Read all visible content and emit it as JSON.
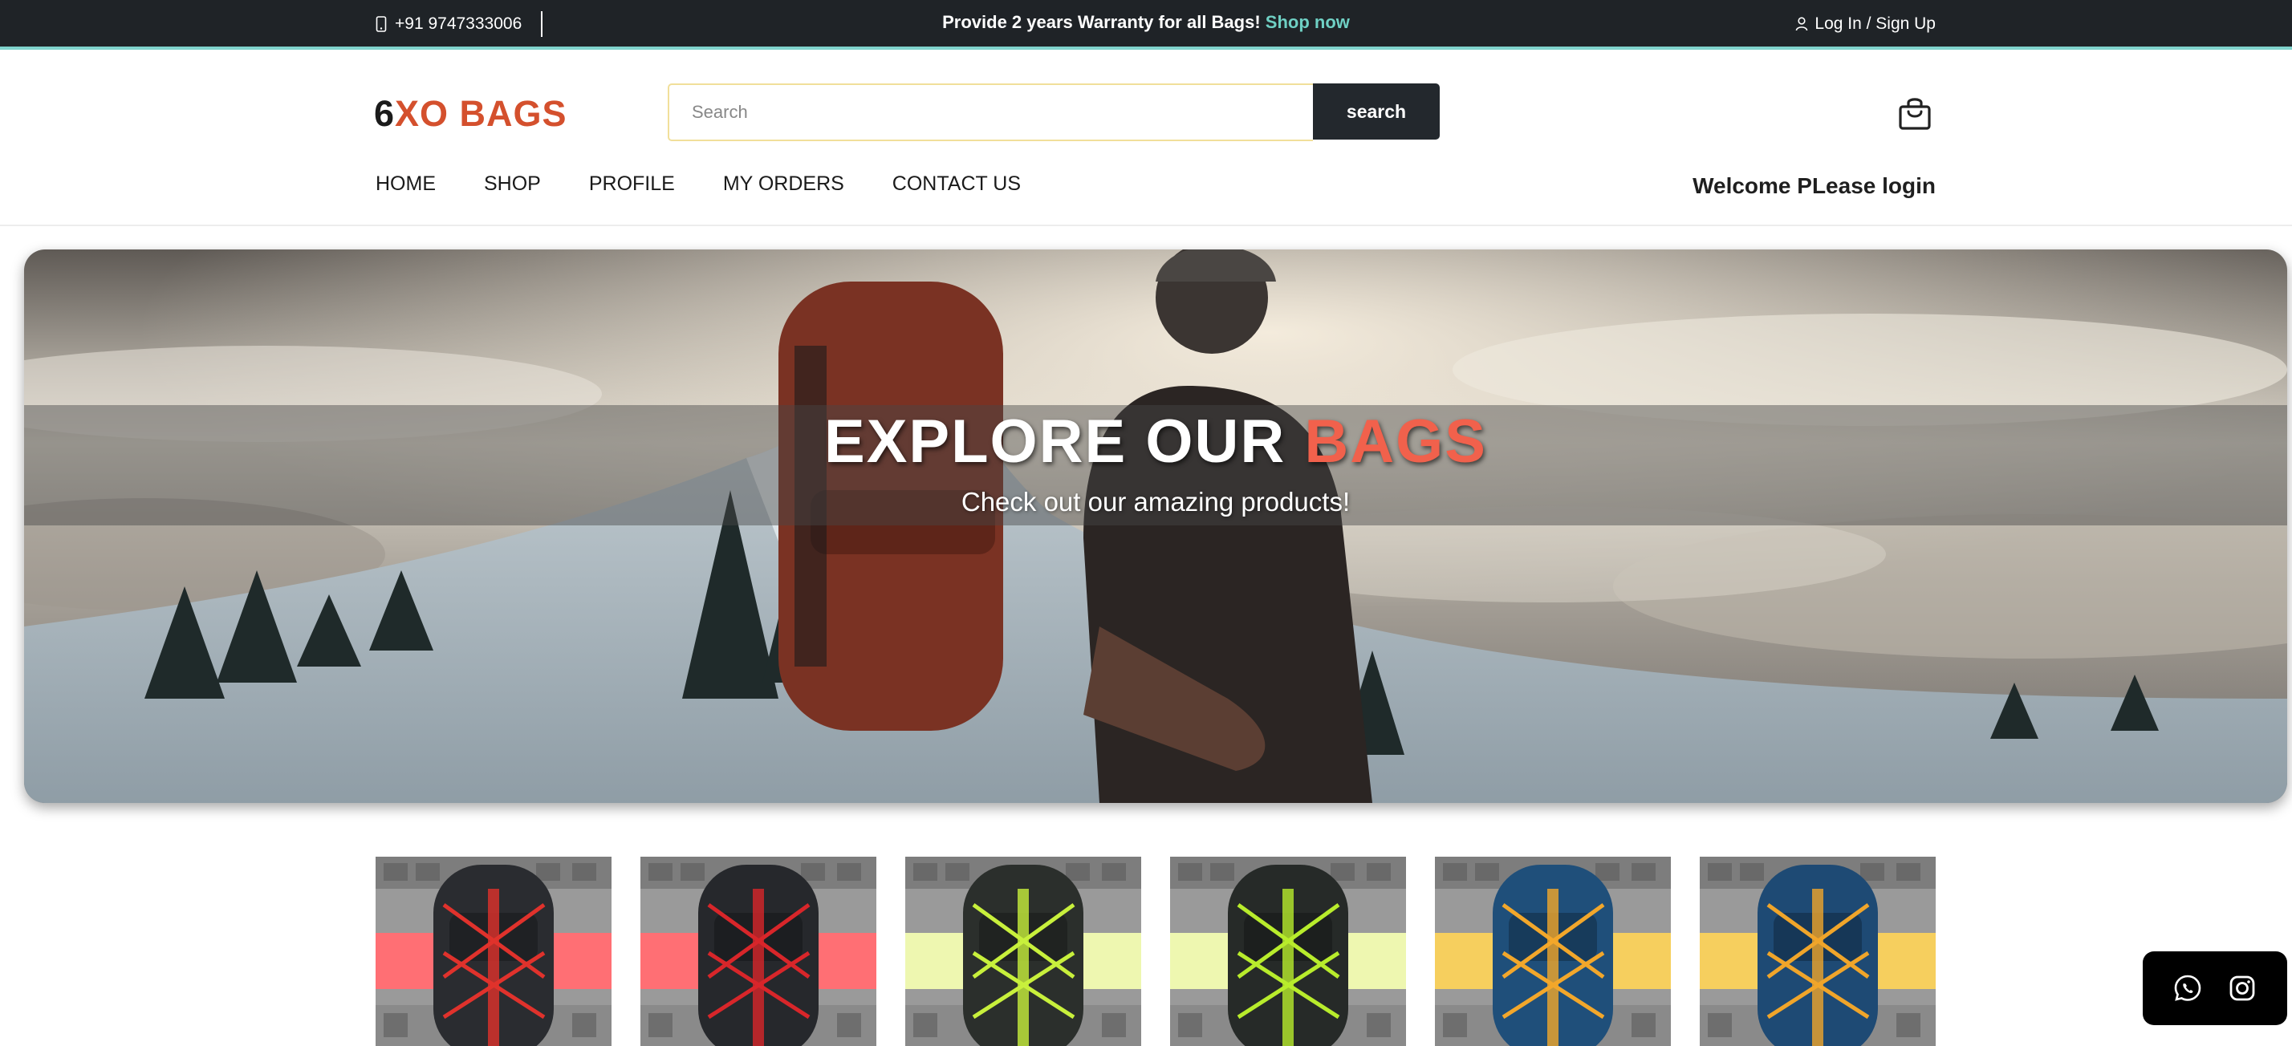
{
  "topbar": {
    "phone": "+91 9747333006",
    "promo_text": "Provide 2 years Warranty for all Bags!",
    "promo_link": "Shop now",
    "login": "Log In / Sign Up"
  },
  "header": {
    "logo_prefix": "6",
    "logo_rest": "XO BAGS",
    "search_placeholder": "Search",
    "search_button": "search",
    "welcome": "Welcome PLease login"
  },
  "nav": {
    "items": [
      {
        "label": "HOME"
      },
      {
        "label": "SHOP"
      },
      {
        "label": "PROFILE"
      },
      {
        "label": "MY ORDERS"
      },
      {
        "label": "CONTACT US"
      }
    ]
  },
  "hero": {
    "title_main": "EXPLORE OUR",
    "title_accent": "BAGS",
    "subtitle": "Check out our amazing products!"
  },
  "products": [
    {
      "bag_color": "#2a2c30",
      "accent": "#e0322c",
      "bg": "#ff6f74"
    },
    {
      "bag_color": "#26282c",
      "accent": "#d8262a",
      "bg": "#ff6f74"
    },
    {
      "bag_color": "#2b2f2c",
      "accent": "#c8f03c",
      "bg": "#eef7b0"
    },
    {
      "bag_color": "#262a28",
      "accent": "#b8ec2c",
      "bg": "#eef7b0"
    },
    {
      "bag_color": "#1f4f7a",
      "accent": "#f2a72b",
      "bg": "#f6cf5e"
    },
    {
      "bag_color": "#1e4a74",
      "accent": "#f0a52a",
      "bg": "#f6cf5e"
    }
  ],
  "social": {
    "icons": [
      "whatsapp-icon",
      "instagram-icon"
    ]
  }
}
